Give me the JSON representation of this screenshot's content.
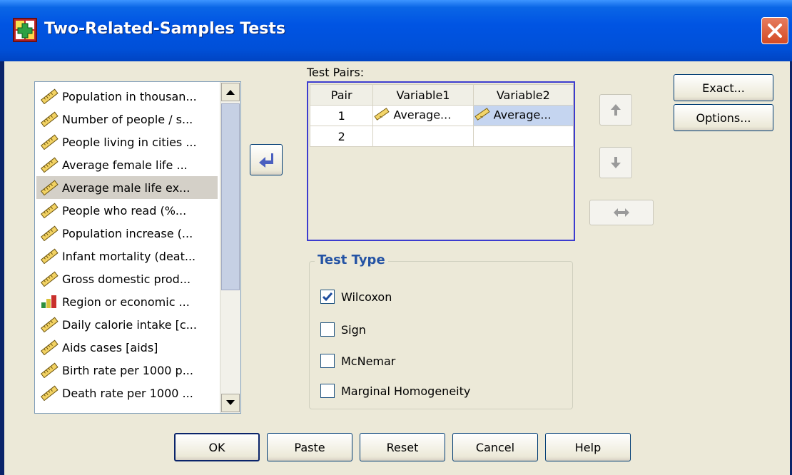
{
  "window": {
    "title": "Two-Related-Samples Tests",
    "close_icon": "close-icon"
  },
  "variables": [
    {
      "label": "Population in thousan...",
      "icon": "scale-ruler-icon"
    },
    {
      "label": "Number of people / s...",
      "icon": "scale-ruler-icon"
    },
    {
      "label": "People living in cities ...",
      "icon": "scale-ruler-icon"
    },
    {
      "label": "Average female life ...",
      "icon": "scale-ruler-icon"
    },
    {
      "label": "Average male life ex...",
      "icon": "scale-ruler-icon",
      "selected": true
    },
    {
      "label": "People who read (%...",
      "icon": "scale-ruler-icon"
    },
    {
      "label": "Population increase (...",
      "icon": "scale-ruler-icon"
    },
    {
      "label": "Infant mortality (deat...",
      "icon": "scale-ruler-icon"
    },
    {
      "label": "Gross domestic prod...",
      "icon": "scale-ruler-icon"
    },
    {
      "label": "Region or economic ...",
      "icon": "nominal-bar-icon"
    },
    {
      "label": "Daily calorie intake [c...",
      "icon": "scale-ruler-icon"
    },
    {
      "label": "Aids cases [aids]",
      "icon": "scale-ruler-icon"
    },
    {
      "label": "Birth rate per 1000 p...",
      "icon": "scale-ruler-icon"
    },
    {
      "label": "Death rate per 1000 ...",
      "icon": "scale-ruler-icon"
    }
  ],
  "test_pairs": {
    "label": "Test Pairs:",
    "columns": [
      "Pair",
      "Variable1",
      "Variable2"
    ],
    "rows": [
      {
        "pair": "1",
        "var1": "Average...",
        "var2": "Average..."
      },
      {
        "pair": "2",
        "var1": "",
        "var2": ""
      }
    ]
  },
  "buttons": {
    "exact": "Exact...",
    "options": "Options...",
    "ok": "OK",
    "paste": "Paste",
    "reset": "Reset",
    "cancel": "Cancel",
    "help": "Help"
  },
  "test_type": {
    "title": "Test Type",
    "options": [
      {
        "label": "Wilcoxon",
        "checked": true
      },
      {
        "label": "Sign",
        "checked": false
      },
      {
        "label": "McNemar",
        "checked": false
      },
      {
        "label": "Marginal Homogeneity",
        "checked": false
      }
    ]
  },
  "colors": {
    "titlebar": "#0054e3",
    "group_title": "#2453a4",
    "selection": "#c5d5f0"
  }
}
